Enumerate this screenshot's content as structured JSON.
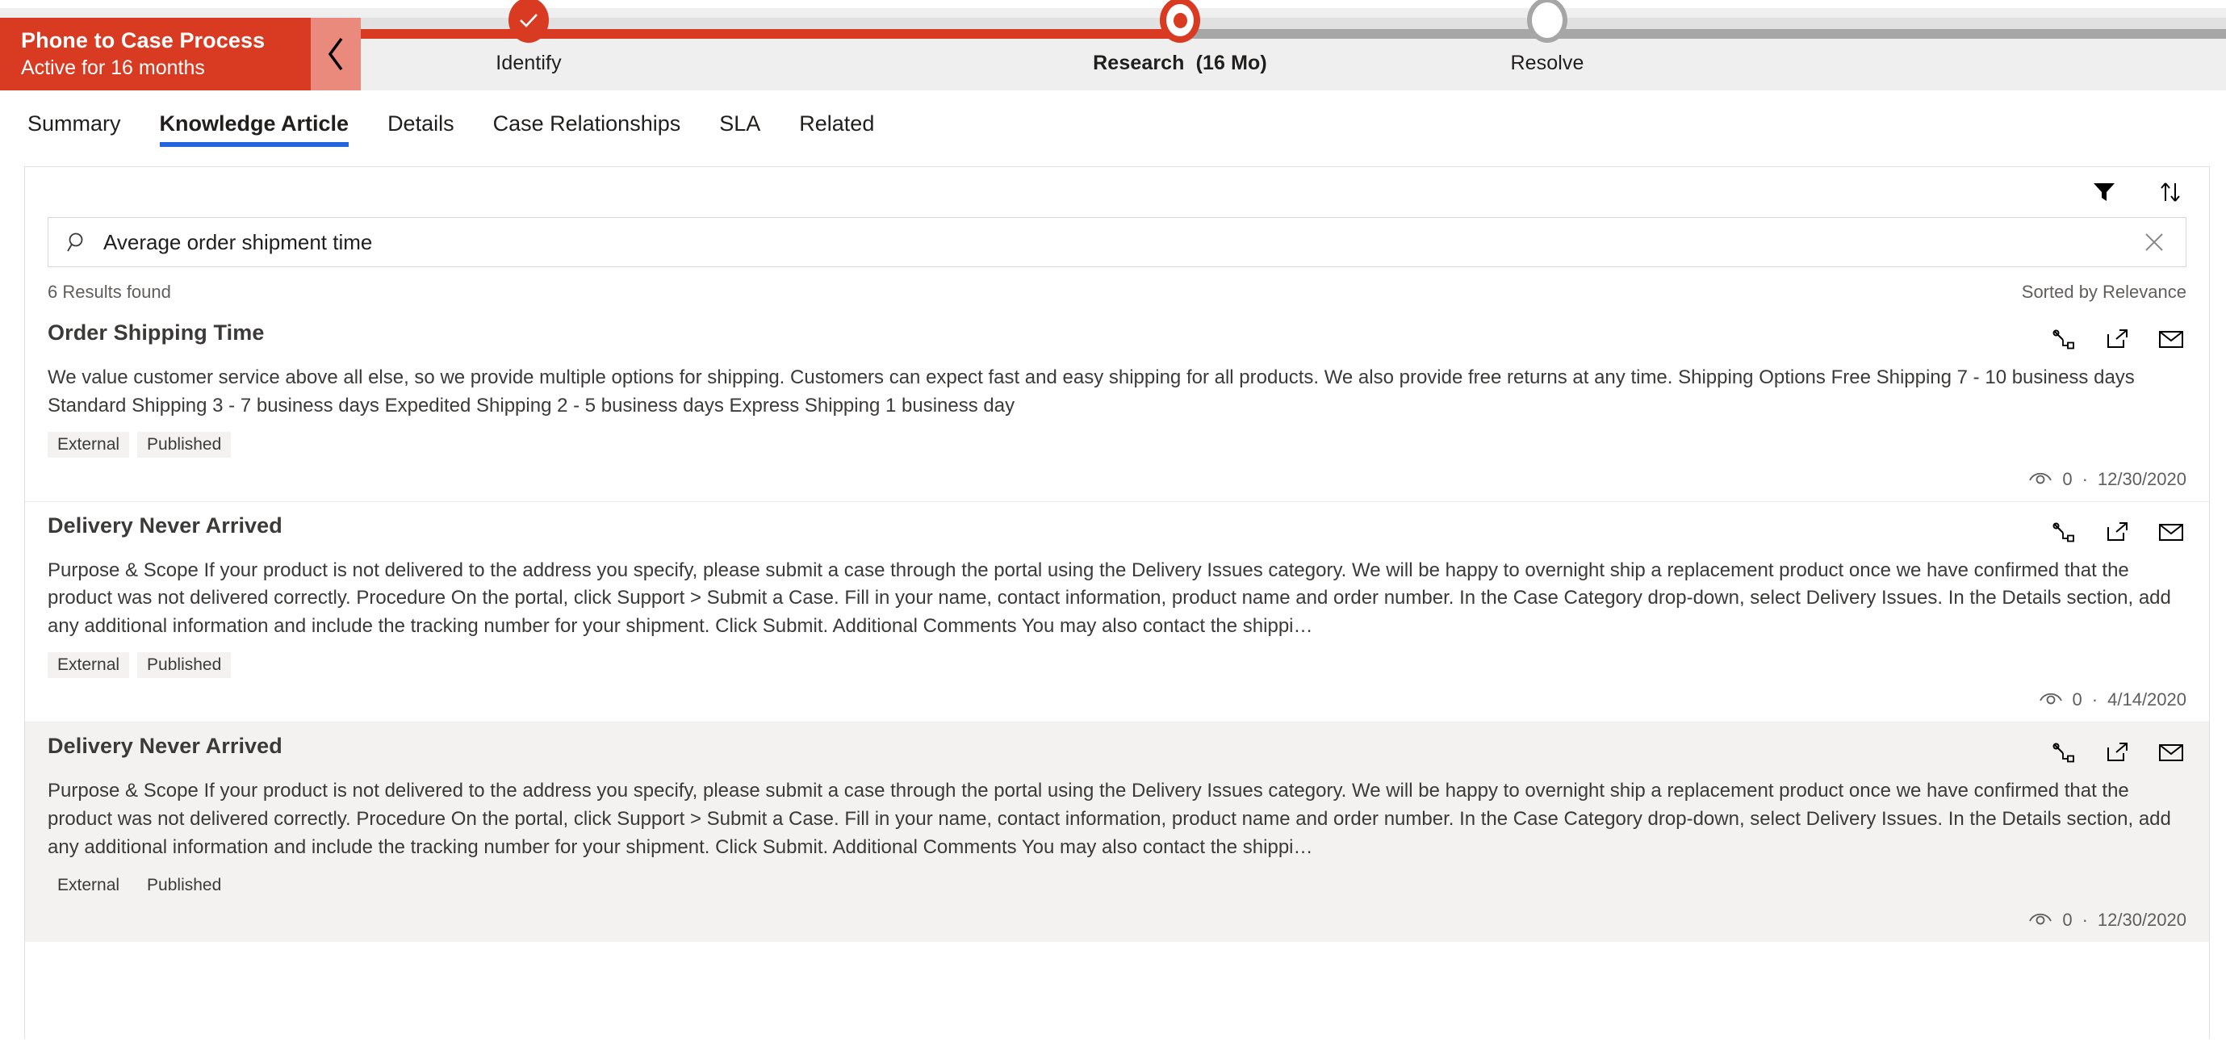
{
  "process": {
    "title": "Phone to Case Process",
    "subtitle": "Active for 16 months",
    "collapse_icon": "chevron-left-icon",
    "stages": [
      {
        "label": "Identify",
        "duration": "",
        "state": "completed",
        "marker": "check-circle-icon"
      },
      {
        "label": "Research",
        "duration": "(16 Mo)",
        "state": "active",
        "marker": "target-circle-icon"
      },
      {
        "label": "Resolve",
        "duration": "",
        "state": "future",
        "marker": "empty-circle-icon"
      }
    ]
  },
  "tabs": [
    {
      "label": "Summary",
      "active": false
    },
    {
      "label": "Knowledge Article",
      "active": true
    },
    {
      "label": "Details",
      "active": false
    },
    {
      "label": "Case Relationships",
      "active": false
    },
    {
      "label": "SLA",
      "active": false
    },
    {
      "label": "Related",
      "active": false
    }
  ],
  "toolbar": {
    "filter_icon": "filter-funnel-icon",
    "sort_icon": "sort-arrows-icon"
  },
  "search": {
    "value": "Average order shipment time",
    "placeholder": "Search knowledge articles",
    "search_icon": "search-icon",
    "clear_icon": "close-icon"
  },
  "results_meta": {
    "count_label": "6 Results found",
    "sort_label": "Sorted by Relevance"
  },
  "row_actions": {
    "link_label": "link-article-icon",
    "popout_label": "open-in-new-window-icon",
    "email_label": "email-article-icon"
  },
  "results": [
    {
      "title": "Order Shipping Time",
      "body": "We value customer service above all else, so we provide multiple options for shipping. Customers can expect fast and easy shipping for all products. We also provide free returns at any time. Shipping Options Free Shipping 7 - 10 business days Standard Shipping 3 - 7 business days Expedited Shipping 2 - 5 business days Express Shipping 1 business day",
      "tags": [
        "External",
        "Published"
      ],
      "views": "0",
      "date": "12/30/2020",
      "highlight": false,
      "lines": 2
    },
    {
      "title": "Delivery Never Arrived",
      "body": "Purpose & Scope If your product is not delivered to the address you specify, please submit a case through the portal using the Delivery Issues category. We will be happy to overnight ship a replacement product once we have confirmed that the product was not delivered correctly. Procedure On the portal, click Support > Submit a Case. Fill in your name, contact information, product name and order number. In the Case Category drop-down, select Delivery Issues. In the Details section, add any additional information and include the tracking number for your shipment. Click Submit. Additional Comments You may also contact the shippi…",
      "tags": [
        "External",
        "Published"
      ],
      "views": "0",
      "date": "4/14/2020",
      "highlight": false,
      "lines": 3
    },
    {
      "title": "Delivery Never Arrived",
      "body": "Purpose & Scope If your product is not delivered to the address you specify, please submit a case through the portal using the Delivery Issues category. We will be happy to overnight ship a replacement product once we have confirmed that the product was not delivered correctly. Procedure On the portal, click Support > Submit a Case. Fill in your name, contact information, product name and order number. In the Case Category drop-down, select Delivery Issues. In the Details section, add any additional information and include the tracking number for your shipment. Click Submit. Additional Comments You may also contact the shippi…",
      "tags": [
        "External",
        "Published"
      ],
      "views": "0",
      "date": "12/30/2020",
      "highlight": true,
      "lines": 3
    }
  ],
  "colors": {
    "brand_red": "#d83b21",
    "tab_accent": "#2266dd",
    "track_future": "#a6a6a6",
    "panel_bg_hover": "#f3f2f1"
  }
}
